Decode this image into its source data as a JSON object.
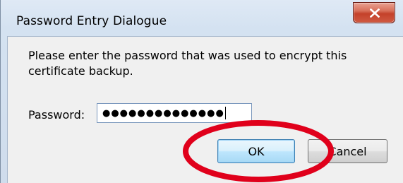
{
  "window": {
    "title": "Password Entry Dialogue",
    "close_label": "X"
  },
  "dialog": {
    "message": "Please enter the password that was used to encrypt this certificate backup.",
    "password_label": "Password:",
    "password_masked": "●●●●●●●●●●●●●●"
  },
  "buttons": {
    "ok_label": "OK",
    "cancel_label": "Cancel"
  },
  "annotation": {
    "shape": "ellipse",
    "target": "ok-button",
    "color": "#e0001b"
  },
  "colors": {
    "titlebar_gradient_top": "#dfe9f5",
    "close_button_red": "#c4412a",
    "client_background": "#f0f0f0",
    "ok_button_focus_border": "#3c7fb1"
  },
  "icons": {
    "close": "close-x-icon"
  }
}
